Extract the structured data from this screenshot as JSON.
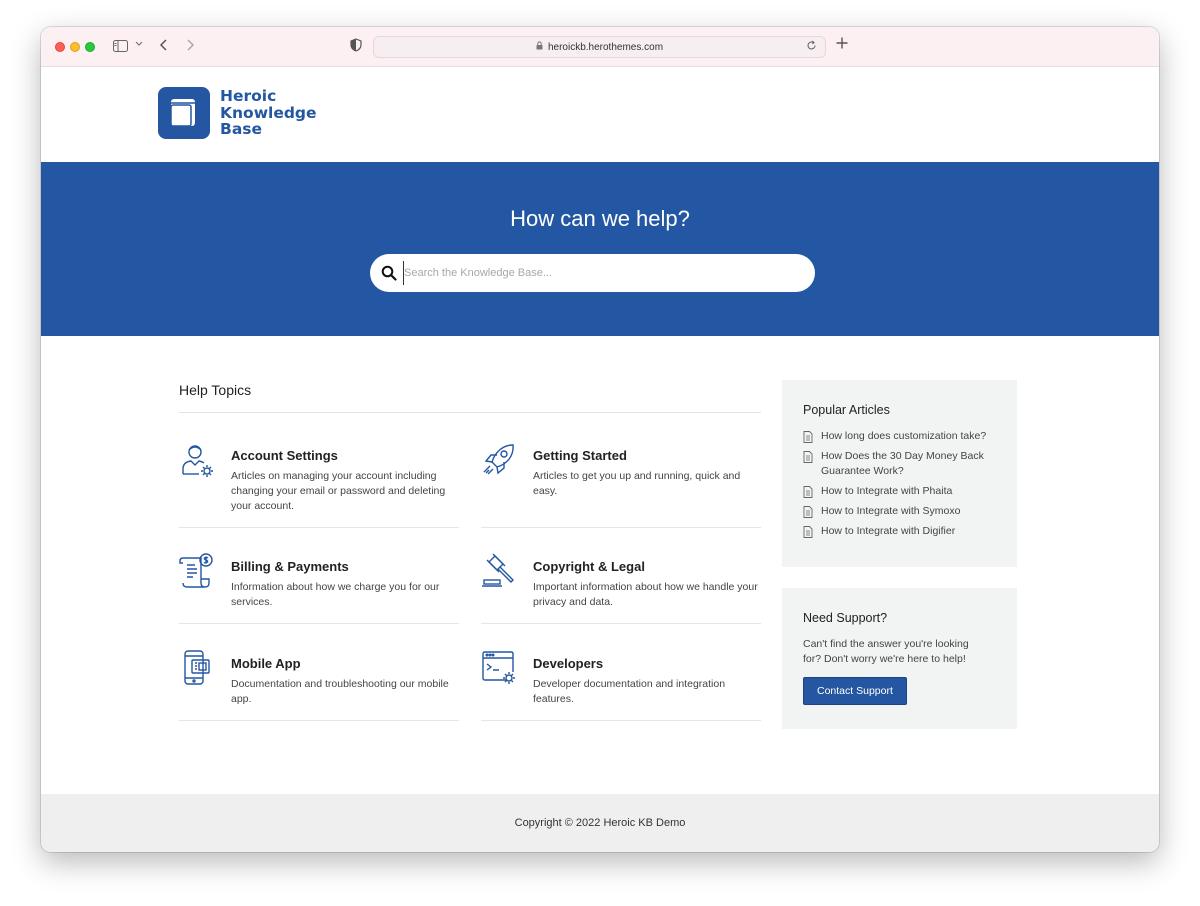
{
  "browser": {
    "url": "heroickb.herothemes.com"
  },
  "logo": {
    "line1": "Heroic",
    "line2": "Knowledge",
    "line3": "Base"
  },
  "hero": {
    "heading": "How can we help?",
    "search_placeholder": "Search the Knowledge Base..."
  },
  "topics": {
    "title": "Help Topics",
    "items": [
      {
        "name": "Account Settings",
        "desc": "Articles on managing your account including changing your email or password and deleting your account.",
        "icon": "user-gear-icon"
      },
      {
        "name": "Getting Started",
        "desc": "Articles to get you up and running, quick and easy.",
        "icon": "rocket-icon"
      },
      {
        "name": "Billing & Payments",
        "desc": "Information about how we charge you for our services.",
        "icon": "billing-scroll-icon"
      },
      {
        "name": "Copyright & Legal",
        "desc": "Important information about how we handle your privacy and data.",
        "icon": "gavel-icon"
      },
      {
        "name": "Mobile App",
        "desc": "Documentation and troubleshooting our mobile app.",
        "icon": "mobile-app-icon"
      },
      {
        "name": "Developers",
        "desc": "Developer documentation and integration features.",
        "icon": "developer-window-icon"
      }
    ]
  },
  "popular": {
    "title": "Popular Articles",
    "articles": [
      "How long does customization take?",
      "How Does the 30 Day Money Back Guarantee Work?",
      "How to Integrate with Phaita",
      "How to Integrate with Symoxo",
      "How to Integrate with Digifier"
    ]
  },
  "support": {
    "title": "Need Support?",
    "text": "Can't find the answer you're looking for? Don't worry we're here to help!",
    "button": "Contact Support"
  },
  "footer": {
    "text": "Copyright © 2022 Heroic KB Demo"
  },
  "colors": {
    "brand": "#2456a2",
    "hero_bg": "#2457a3",
    "sidebar_bg": "#f2f3f3",
    "footer_bg": "#efefef"
  }
}
